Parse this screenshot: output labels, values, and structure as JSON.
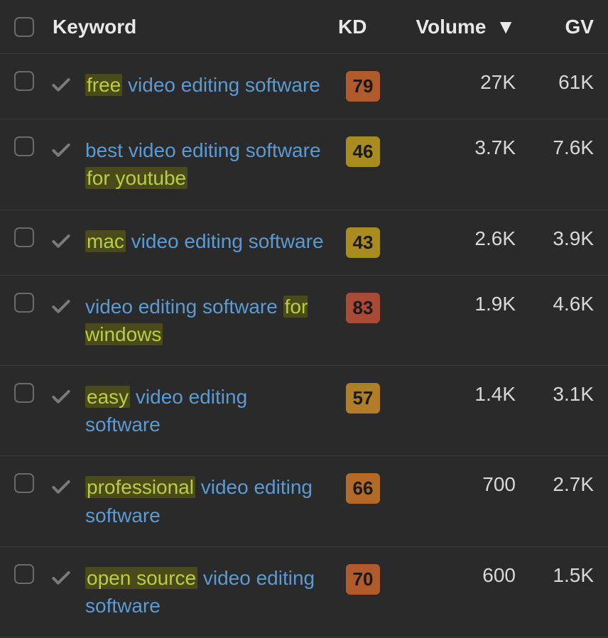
{
  "columns": {
    "keyword": "Keyword",
    "kd": "KD",
    "volume": "Volume",
    "gv": "GV"
  },
  "sort_indicator": "▼",
  "rows": [
    {
      "keyword_parts": [
        {
          "text": "free",
          "hl": true
        },
        {
          "text": " video editing software",
          "hl": false
        }
      ],
      "kd": "79",
      "kd_color": "#b15a2e",
      "volume": "27K",
      "gv": "61K"
    },
    {
      "keyword_parts": [
        {
          "text": "best video editing software ",
          "hl": false
        },
        {
          "text": "for youtube",
          "hl": true
        }
      ],
      "kd": "46",
      "kd_color": "#a98c1f",
      "volume": "3.7K",
      "gv": "7.6K"
    },
    {
      "keyword_parts": [
        {
          "text": "mac",
          "hl": true
        },
        {
          "text": " video editing software",
          "hl": false
        }
      ],
      "kd": "43",
      "kd_color": "#a98c1f",
      "volume": "2.6K",
      "gv": "3.9K"
    },
    {
      "keyword_parts": [
        {
          "text": "video editing software ",
          "hl": false
        },
        {
          "text": "for windows",
          "hl": true
        }
      ],
      "kd": "83",
      "kd_color": "#a84a36",
      "volume": "1.9K",
      "gv": "4.6K"
    },
    {
      "keyword_parts": [
        {
          "text": "easy",
          "hl": true
        },
        {
          "text": " video editing software",
          "hl": false
        }
      ],
      "kd": "57",
      "kd_color": "#b07e27",
      "volume": "1.4K",
      "gv": "3.1K"
    },
    {
      "keyword_parts": [
        {
          "text": "professional",
          "hl": true
        },
        {
          "text": " video editing software",
          "hl": false
        }
      ],
      "kd": "66",
      "kd_color": "#b26a28",
      "volume": "700",
      "gv": "2.7K"
    },
    {
      "keyword_parts": [
        {
          "text": "open source",
          "hl": true
        },
        {
          "text": " video editing software",
          "hl": false
        }
      ],
      "kd": "70",
      "kd_color": "#b15a2e",
      "volume": "600",
      "gv": "1.5K"
    }
  ]
}
